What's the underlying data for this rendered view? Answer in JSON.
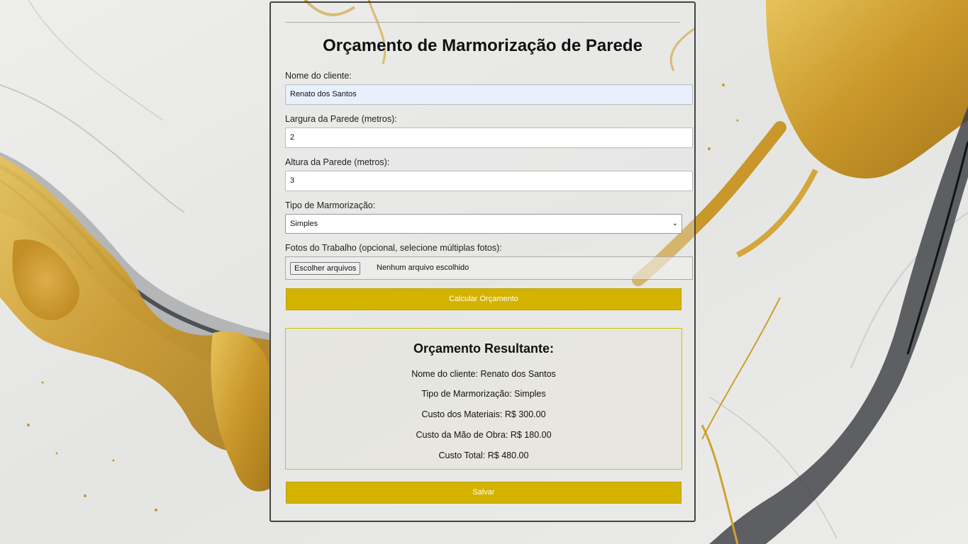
{
  "form": {
    "title": "Orçamento de Marmorização de Parede",
    "client_name_label": "Nome do cliente:",
    "client_name_value": "Renato dos Santos",
    "width_label": "Largura da Parede (metros):",
    "width_value": "2",
    "height_label": "Altura da Parede (metros):",
    "height_value": "3",
    "type_label": "Tipo de Marmorização:",
    "type_value": "Simples",
    "photos_label": "Fotos do Trabalho (opcional, selecione múltiplas fotos):",
    "file_button": "Escolher arquivos",
    "file_status": "Nenhum arquivo escolhido",
    "calc_button": "Calcular Orçamento"
  },
  "result": {
    "title": "Orçamento Resultante:",
    "client_line": "Nome do cliente: Renato dos Santos",
    "type_line": "Tipo de Marmorização: Simples",
    "materials_line": "Custo dos Materiais: R$ 300.00",
    "labor_line": "Custo da Mão de Obra: R$ 180.00",
    "total_line": "Custo Total: R$ 480.00"
  },
  "actions": {
    "save_button": "Salvar"
  },
  "colors": {
    "button": "#d4b300",
    "gold": "#c9a227"
  }
}
